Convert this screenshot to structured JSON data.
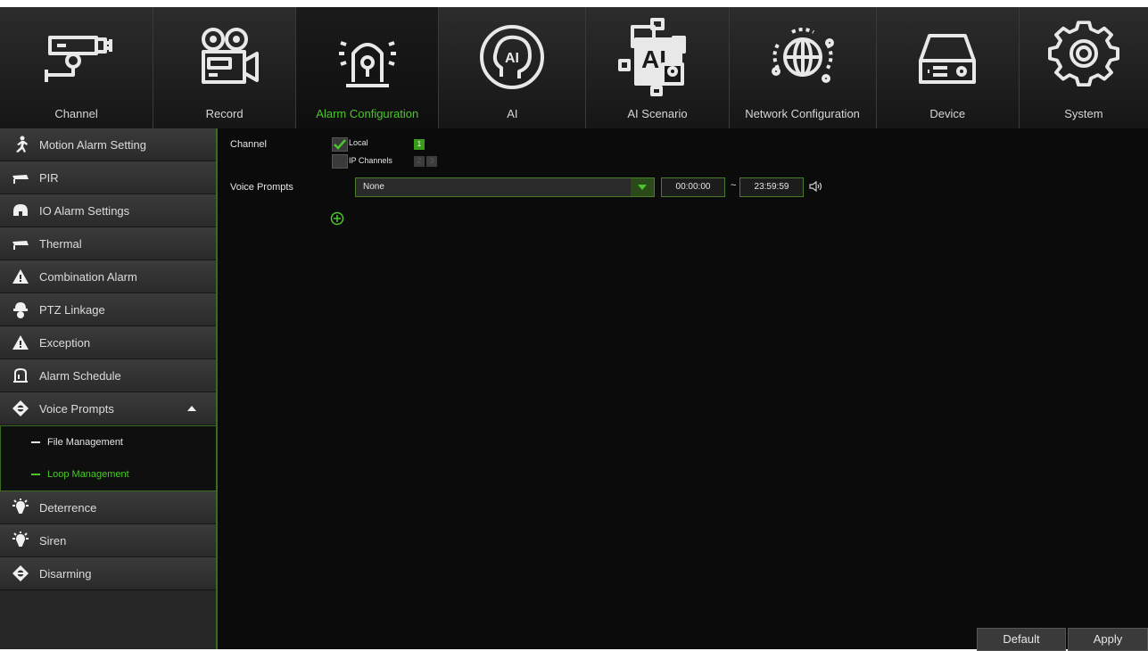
{
  "nav": {
    "items": [
      {
        "label": "Channel",
        "icon": "cctv-camera-icon"
      },
      {
        "label": "Record",
        "icon": "video-camera-icon"
      },
      {
        "label": "Alarm Configuration",
        "icon": "alarm-siren-icon"
      },
      {
        "label": "AI",
        "icon": "ai-head-icon"
      },
      {
        "label": "AI Scenario",
        "icon": "ai-scenario-icon"
      },
      {
        "label": "Network Configuration",
        "icon": "globe-network-icon"
      },
      {
        "label": "Device",
        "icon": "hard-drive-icon"
      },
      {
        "label": "System",
        "icon": "gear-icon"
      }
    ],
    "active_index": 2
  },
  "sidebar": {
    "items": [
      {
        "label": "Motion Alarm Setting",
        "icon": "running-man-icon"
      },
      {
        "label": "PIR",
        "icon": "pir-sensor-icon"
      },
      {
        "label": "IO Alarm Settings",
        "icon": "io-alarm-icon"
      },
      {
        "label": "Thermal",
        "icon": "thermal-camera-icon"
      },
      {
        "label": "Combination Alarm",
        "icon": "warning-triangle-icon"
      },
      {
        "label": "PTZ Linkage",
        "icon": "ptz-camera-icon"
      },
      {
        "label": "Exception",
        "icon": "warning-triangle-icon"
      },
      {
        "label": "Alarm Schedule",
        "icon": "alarm-bell-icon"
      },
      {
        "label": "Voice Prompts",
        "icon": "voice-prompts-icon",
        "expanded": true
      },
      {
        "label": "Deterrence",
        "icon": "light-bulb-icon"
      },
      {
        "label": "Siren",
        "icon": "light-bulb-icon"
      },
      {
        "label": "Disarming",
        "icon": "disarming-icon"
      }
    ],
    "sub_items": [
      {
        "label": "File Management",
        "active": false
      },
      {
        "label": "Loop Management",
        "active": true
      }
    ]
  },
  "main": {
    "channel_label": "Channel",
    "local_label": "Local",
    "local_checked": true,
    "local_channels": [
      "1"
    ],
    "ip_channels_label": "IP Channels",
    "ip_channels_checked": false,
    "ip_channels": [
      "2",
      "3"
    ],
    "voice_prompts_label": "Voice Prompts",
    "voice_prompts_value": "None",
    "start_time": "00:00:00",
    "time_separator": "~",
    "end_time": "23:59:59"
  },
  "buttons": {
    "default": "Default",
    "apply": "Apply"
  },
  "colors": {
    "accent": "#4cc72b",
    "panel": "#262626",
    "background": "#0b0b0b"
  }
}
